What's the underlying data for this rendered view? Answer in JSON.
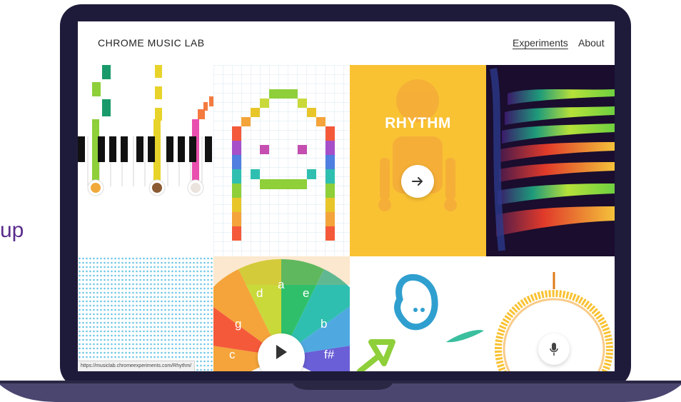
{
  "side": {
    "text": "up"
  },
  "header": {
    "brand": "CHROME MUSIC LAB",
    "nav": [
      {
        "label": "Experiments",
        "active": true
      },
      {
        "label": "About",
        "active": false
      }
    ]
  },
  "tiles": {
    "rhythm": {
      "label": "RHYTHM",
      "button_icon": "arrow-right-icon"
    },
    "chords": {
      "notes": [
        "d",
        "a",
        "e",
        "g",
        "b",
        "c",
        "f#"
      ]
    },
    "voice": {
      "button_icon": "microphone-icon"
    }
  },
  "status_bar": {
    "url": "https://musiclab.chromeexperiments.com/Rhythm/"
  },
  "colors": {
    "laptop_frame": "#1e1b3a",
    "laptop_base": "#4a4670",
    "rhythm_bg": "#f9c233",
    "side_text": "#5a2d8c"
  }
}
